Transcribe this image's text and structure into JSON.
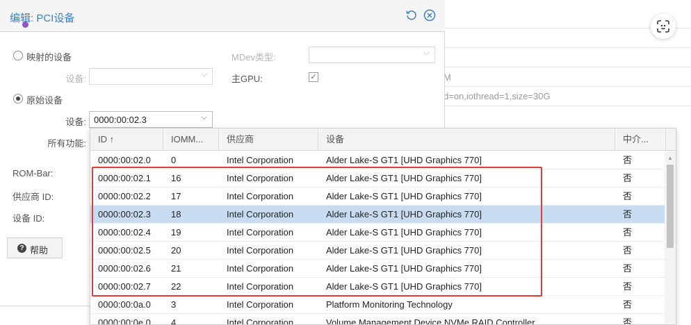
{
  "background": {
    "text_m": "M",
    "text_params": "d=on,iothread=1,size=30G"
  },
  "dialog": {
    "title": "编辑: PCI设备",
    "mapped_device_label": "映射的设备",
    "mapped_device_field_label": "设备:",
    "mdev_type_label": "MDev类型:",
    "primary_gpu_label": "主GPU:",
    "primary_gpu_checked": true,
    "raw_device_label": "原始设备",
    "raw_device_field_label": "设备:",
    "raw_device_value": "0000:00:02.3",
    "all_functions_label": "所有功能:",
    "rom_bar_label": "ROM-Bar:",
    "vendor_id_label": "供应商 ID:",
    "device_id_label": "设备 ID:",
    "help_label": "帮助"
  },
  "grid": {
    "columns": [
      "ID ↑",
      "IOMM...",
      "供应商",
      "设备",
      "中介..."
    ],
    "selected_row": 3,
    "rows": [
      [
        "0000:00:02.0",
        "0",
        "Intel Corporation",
        "Alder Lake-S GT1 [UHD Graphics 770]",
        "否"
      ],
      [
        "0000:00:02.1",
        "16",
        "Intel Corporation",
        "Alder Lake-S GT1 [UHD Graphics 770]",
        "否"
      ],
      [
        "0000:00:02.2",
        "17",
        "Intel Corporation",
        "Alder Lake-S GT1 [UHD Graphics 770]",
        "否"
      ],
      [
        "0000:00:02.3",
        "18",
        "Intel Corporation",
        "Alder Lake-S GT1 [UHD Graphics 770]",
        "否"
      ],
      [
        "0000:00:02.4",
        "19",
        "Intel Corporation",
        "Alder Lake-S GT1 [UHD Graphics 770]",
        "否"
      ],
      [
        "0000:00:02.5",
        "20",
        "Intel Corporation",
        "Alder Lake-S GT1 [UHD Graphics 770]",
        "否"
      ],
      [
        "0000:00:02.6",
        "21",
        "Intel Corporation",
        "Alder Lake-S GT1 [UHD Graphics 770]",
        "否"
      ],
      [
        "0000:00:02.7",
        "22",
        "Intel Corporation",
        "Alder Lake-S GT1 [UHD Graphics 770]",
        "否"
      ],
      [
        "0000:00:0a.0",
        "3",
        "Intel Corporation",
        "Platform Monitoring Technology",
        "否"
      ],
      [
        "0000:00:0e.0",
        "4",
        "Intel Corporation",
        "Volume Management Device NVMe RAID Controller",
        "否"
      ]
    ]
  },
  "icons": {
    "reset": "reset-icon",
    "close": "close-circle-icon",
    "focus": "focus-scan-icon",
    "help": "help-circle-icon"
  },
  "colors": {
    "title_blue": "#3b7fc4",
    "selected_row": "#c7dcf0",
    "highlight_box": "#e53935"
  }
}
